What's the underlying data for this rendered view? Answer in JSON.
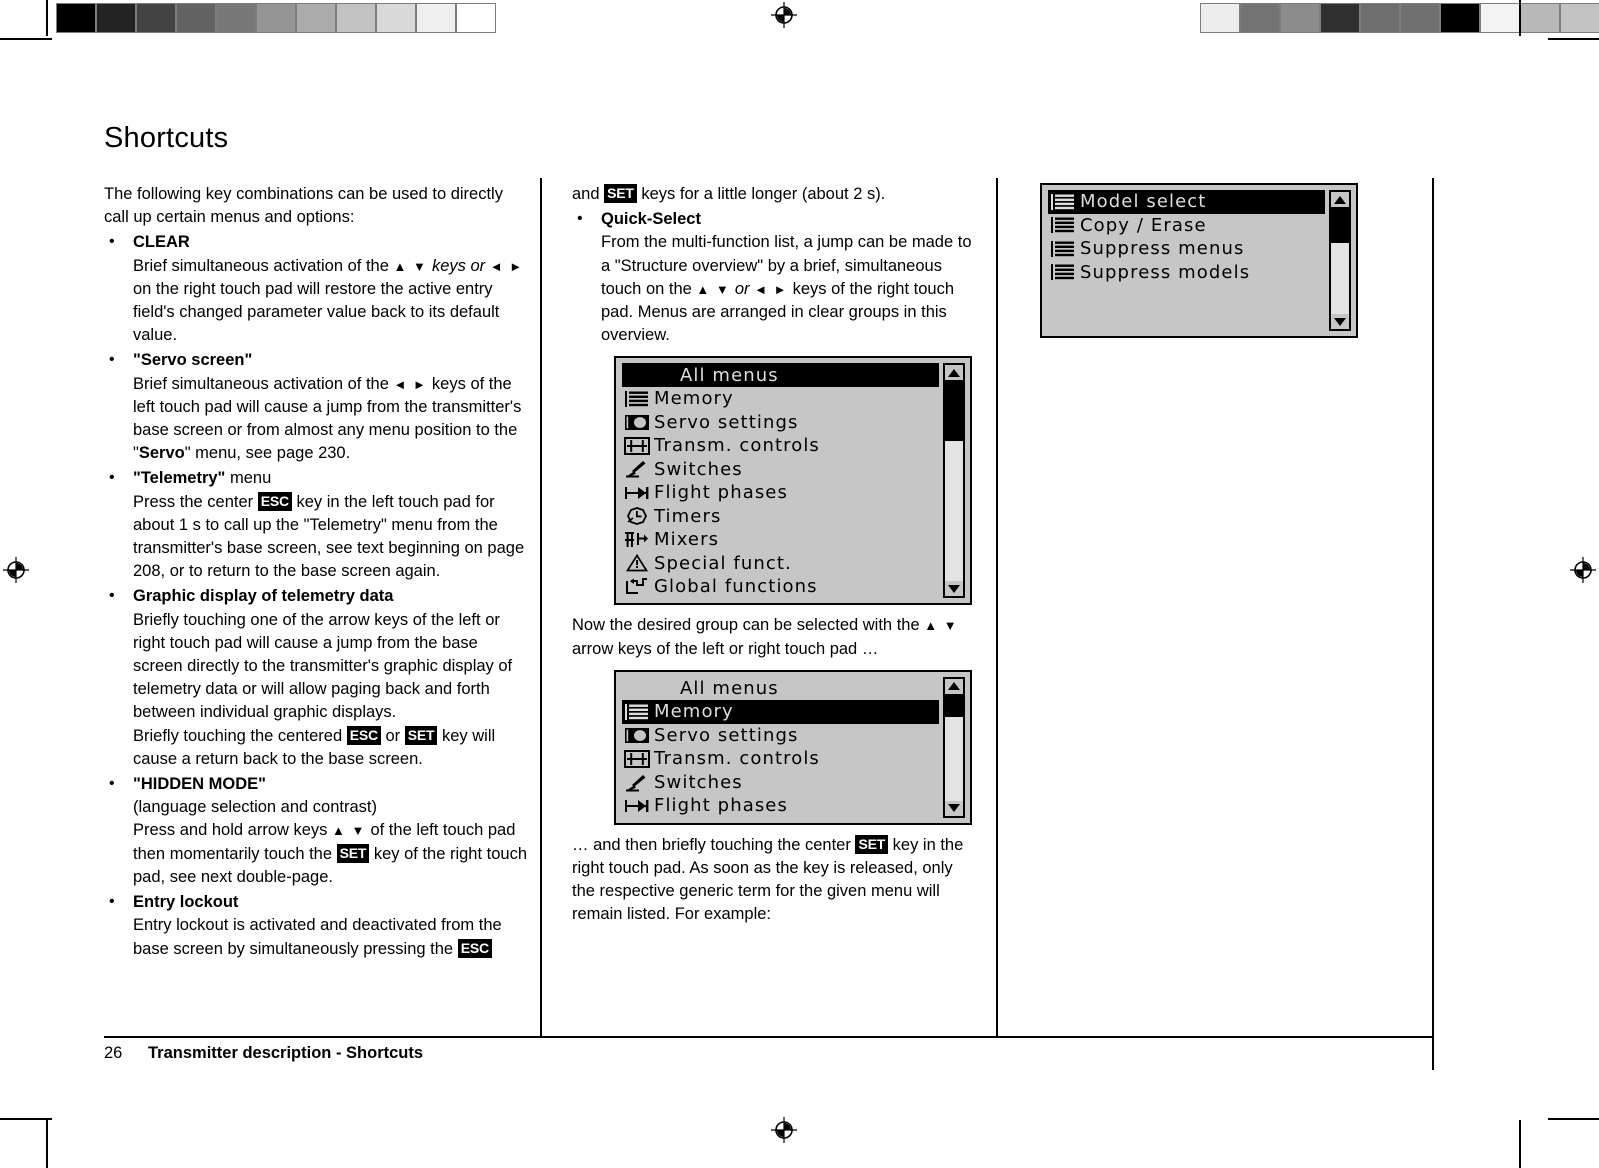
{
  "page": {
    "title": "Shortcuts",
    "number": "26",
    "footer_text": "Transmitter description - Shortcuts"
  },
  "calibration": {
    "left_swatches": [
      "#000000",
      "#232323",
      "#434343",
      "#636363",
      "#787878",
      "#959595",
      "#ababab",
      "#c2c2c2",
      "#d9d9d9",
      "#efefef",
      "#ffffff"
    ],
    "right_swatches": [
      "#ededed",
      "#737373",
      "#8c8c8c",
      "#303030",
      "#6e6e6e",
      "#717171",
      "#000000",
      "#f3f3f3",
      "#b8b8b8",
      "#c3c3c3",
      "#a3a3a3"
    ]
  },
  "left_column": {
    "intro": "The following key combinations can be used to directly call up certain menus and options:",
    "items": [
      {
        "term": "CLEAR",
        "term_quoted": false,
        "body_html": "Brief simultaneous activation of the <span class=\"ar\">▲ ▼</span> <span class=\"i\">keys or</span> <span class=\"ar\">◄ ►</span> on the right touch pad will restore the active entry field's changed parameter value back to its default value."
      },
      {
        "term": "Servo screen",
        "term_quoted": true,
        "body_html": "Brief simultaneous activation of the <span class=\"ar\">◄ ►</span> keys of the left touch pad will cause a jump from the transmitter's base screen or from almost any menu position to the \"<b>Servo</b>\" menu, see page 230."
      },
      {
        "term": "Telemetry",
        "term_quoted": true,
        "term_suffix": " menu",
        "body_html": "Press the center <span class=\"key\">ESC</span> key in the left touch pad for about 1 s to call up the \"Telemetry\" menu from the transmitter's base screen, see text beginning on page 208, or to return to the base screen again."
      },
      {
        "term": "Graphic display of telemetry data",
        "term_quoted": false,
        "body_html": "Briefly touching one of the arrow keys of the left or right touch pad will cause a jump from the base screen directly to the transmitter's graphic display of telemetry data or will allow paging back and forth between individual graphic displays.<br>Briefly touching the centered <span class=\"key\">ESC</span> or <span class=\"key\">SET</span> key will cause a return back to the base screen."
      },
      {
        "term": "HIDDEN MODE",
        "term_quoted": true,
        "body_html": "(language selection and contrast)<br>Press and hold arrow keys <span class=\"ar\">▲ ▼</span> of the left touch pad then momentarily touch the <span class=\"key\">SET</span> key of the right touch pad, see next double-page."
      },
      {
        "term": "Entry lockout",
        "term_quoted": false,
        "body_html": "Entry lockout is activated and deactivated from the base screen by simultaneously pressing the <span class=\"key\">ESC</span>"
      }
    ]
  },
  "middle_column": {
    "continuation_html": "and <span class=\"key\">SET</span> keys for a little longer (about 2 s).",
    "items": [
      {
        "term": "Quick-Select",
        "body_html": "From the multi-function list, a jump can be made to a \"Structure overview\" by a brief, simultaneous touch on the <span class=\"ar\">▲ ▼</span> <span class=\"i\">or</span> <span class=\"ar\">◄ ►</span> keys of the right touch pad. Menus are arranged in clear groups in this overview."
      }
    ],
    "caption_1_html": "Now the desired group can be selected with the <span class=\"ar\">▲ ▼</span> arrow keys of the left or right touch pad …",
    "caption_2_html": "… and then briefly touching the center <span class=\"key\">SET</span> key in the right touch pad. As soon as the key is released, only the respective generic term for the given menu will remain listed. For example:"
  },
  "lcd_screens": [
    {
      "id": "all-menus-unselected",
      "title": "All menus",
      "title_selected": true,
      "rows": [
        {
          "icon": "memory-lines-icon",
          "label": "Memory",
          "selected": false
        },
        {
          "icon": "servo-settings-icon",
          "label": "Servo settings",
          "selected": false
        },
        {
          "icon": "transm-controls-icon",
          "label": "Transm. controls",
          "selected": false
        },
        {
          "icon": "switches-icon",
          "label": "Switches",
          "selected": false
        },
        {
          "icon": "flight-phases-icon",
          "label": "Flight phases",
          "selected": false
        },
        {
          "icon": "timers-clock-icon",
          "label": "Timers",
          "selected": false
        },
        {
          "icon": "mixers-icon",
          "label": "Mixers",
          "selected": false
        },
        {
          "icon": "special-funct-icon",
          "label": "Special funct.",
          "selected": false
        },
        {
          "icon": "global-functions-icon",
          "label": "Global functions",
          "selected": false
        }
      ],
      "scroll": {
        "thumb_top_pct": 0,
        "thumb_height_pct": 30
      }
    },
    {
      "id": "all-menus-memory-selected",
      "title": "All menus",
      "title_selected": false,
      "rows": [
        {
          "icon": "memory-lines-icon",
          "label": "Memory",
          "selected": true
        },
        {
          "icon": "servo-settings-icon",
          "label": "Servo settings",
          "selected": false
        },
        {
          "icon": "transm-controls-icon",
          "label": "Transm. controls",
          "selected": false
        },
        {
          "icon": "switches-icon",
          "label": "Switches",
          "selected": false
        },
        {
          "icon": "flight-phases-icon",
          "label": "Flight phases",
          "selected": false
        }
      ],
      "scroll": {
        "thumb_top_pct": 0,
        "thumb_height_pct": 22
      }
    },
    {
      "id": "memory-group-expanded",
      "title": null,
      "title_selected": false,
      "rows": [
        {
          "icon": "memory-lines-icon",
          "label": "Model select",
          "selected": true
        },
        {
          "icon": "memory-lines-icon",
          "label": "Copy / Erase",
          "selected": false
        },
        {
          "icon": "memory-lines-icon",
          "label": "Suppress menus",
          "selected": false
        },
        {
          "icon": "memory-lines-icon",
          "label": "Suppress models",
          "selected": false
        }
      ],
      "scroll": {
        "thumb_top_pct": 0,
        "thumb_height_pct": 34
      }
    }
  ]
}
